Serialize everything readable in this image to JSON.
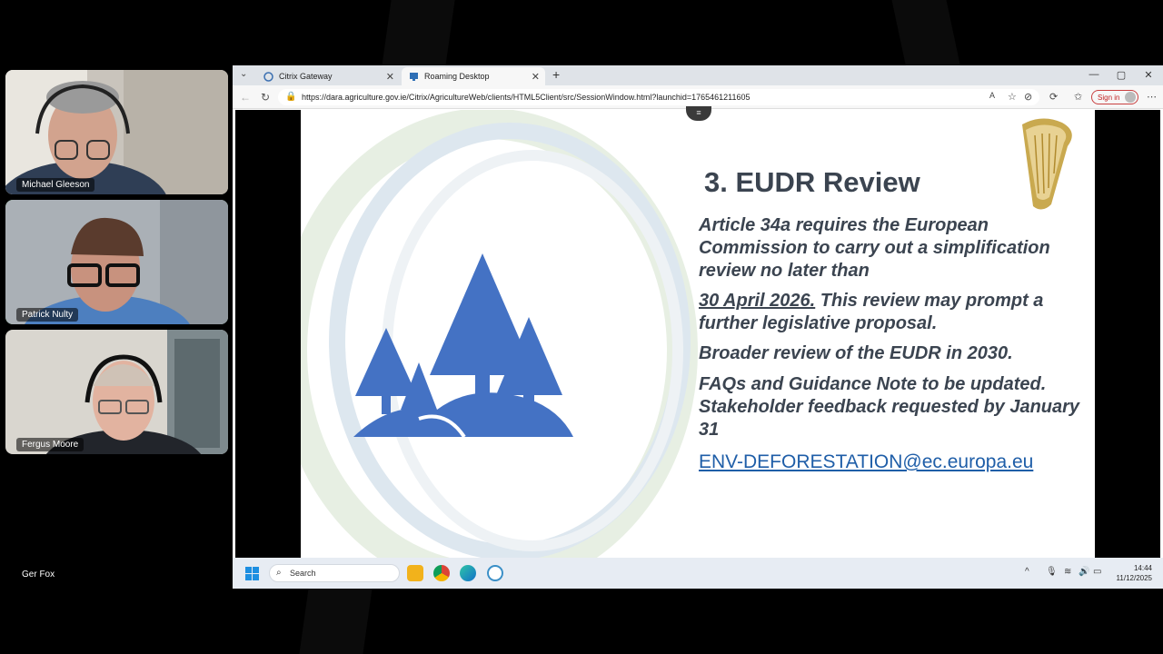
{
  "participants": [
    {
      "name": "Michael Gleeson"
    },
    {
      "name": "Patrick Nulty"
    },
    {
      "name": "Fergus Moore"
    },
    {
      "name": "Ger Fox"
    }
  ],
  "browser": {
    "tabs": [
      {
        "label": "Citrix Gateway",
        "icon": "citrix-icon"
      },
      {
        "label": "Roaming Desktop",
        "icon": "desktop-icon"
      }
    ],
    "new_tab": "+",
    "url": "https://dara.agriculture.gov.ie/Citrix/AgricultureWeb/clients/HTML5Client/src/SessionWindow.html?launchid=1765461211605",
    "sign_in_label": "Sign in"
  },
  "slide": {
    "title": "3. EUDR Review",
    "bullet1": "Article 34a requires the European Commission to carry out a simplification review no later than",
    "bullet2_date": "30 April 2026.",
    "bullet2_rest": " This review may prompt a further legislative proposal.",
    "bullet3": "Broader review of the EUDR in 2030.",
    "bullet4": "FAQs and Guidance Note to be updated. Stakeholder feedback requested by January 31",
    "email": "ENV-DEFORESTATION@ec.europa.eu",
    "accent_color": "#4472c4"
  },
  "taskbar": {
    "search_placeholder": "Search",
    "time": "14:44",
    "date": "11/12/2025"
  }
}
